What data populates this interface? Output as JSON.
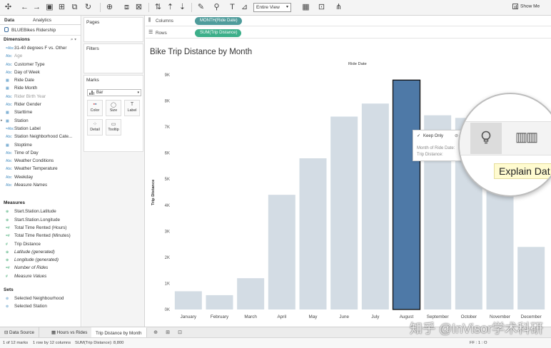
{
  "toolbar": {
    "fit_label": "Entire View",
    "show_me_label": "Show Me"
  },
  "data_pane": {
    "tabs": [
      "Data",
      "Analytics"
    ],
    "datasource": "BLUEBikes Ridership",
    "dimensions_header": "Dimensions",
    "dimensions": [
      {
        "type": "=Abc",
        "name": "31-40 degrees F vs. Other",
        "style": "dim"
      },
      {
        "type": "Abc",
        "name": "Age",
        "style": "muted"
      },
      {
        "type": "Abc",
        "name": "Customer Type",
        "style": "dim"
      },
      {
        "type": "Abc",
        "name": "Day of Week",
        "style": "dim"
      },
      {
        "type": "▦",
        "name": "Ride Date",
        "style": "dim"
      },
      {
        "type": "▦",
        "name": "Ride Month",
        "style": "dim"
      },
      {
        "type": "Abc",
        "name": "Rider Birth Year",
        "style": "muted"
      },
      {
        "type": "Abc",
        "name": "Rider Gender",
        "style": "dim"
      },
      {
        "type": "▦",
        "name": "Starttime",
        "style": "dim"
      },
      {
        "type": "▦",
        "name": "Station",
        "style": "dim",
        "arrow": true
      },
      {
        "type": "=Abc",
        "name": "Station Label",
        "style": "dim"
      },
      {
        "type": "Abc",
        "name": "Station Neighborhood Cate...",
        "style": "dim"
      },
      {
        "type": "▦",
        "name": "Stoptime",
        "style": "dim"
      },
      {
        "type": "Abc",
        "name": "Time of Day",
        "style": "dim"
      },
      {
        "type": "Abc",
        "name": "Weather Conditions",
        "style": "dim"
      },
      {
        "type": "Abc",
        "name": "Weather Temperature",
        "style": "dim"
      },
      {
        "type": "Abc",
        "name": "Weekday",
        "style": "dim"
      },
      {
        "type": "Abc",
        "name": "Measure Names",
        "style": "italic"
      }
    ],
    "measures_header": "Measures",
    "measures": [
      {
        "type": "⊕",
        "name": "Start.Station.Latitude",
        "style": "measure"
      },
      {
        "type": "⊕",
        "name": "Start.Station.Longitude",
        "style": "measure"
      },
      {
        "type": "=#",
        "name": "Total Time Rented (Hours)",
        "style": "measure"
      },
      {
        "type": "=#",
        "name": "Total Time Rented (Minutes)",
        "style": "measure"
      },
      {
        "type": "#",
        "name": "Trip Distance",
        "style": "measure"
      },
      {
        "type": "⊕",
        "name": "Latitude (generated)",
        "style": "measure italic"
      },
      {
        "type": "⊕",
        "name": "Longitude (generated)",
        "style": "measure italic"
      },
      {
        "type": "=#",
        "name": "Number of Rides",
        "style": "measure italic"
      },
      {
        "type": "#",
        "name": "Measure Values",
        "style": "measure italic"
      }
    ],
    "sets_header": "Sets",
    "sets": [
      {
        "type": "⊚",
        "name": "Selected Neighbourhood",
        "style": "dim"
      },
      {
        "type": "⊚",
        "name": "Selected Station",
        "style": "dim"
      }
    ]
  },
  "cards": {
    "pages": "Pages",
    "filters": "Filters",
    "marks": "Marks",
    "mark_type": "Bar",
    "buttons": [
      {
        "label": "Color",
        "icon": "▪▪"
      },
      {
        "label": "Size",
        "icon": "◯"
      },
      {
        "label": "Label",
        "icon": "T"
      },
      {
        "label": "Detail",
        "icon": "⁘"
      },
      {
        "label": "Tooltip",
        "icon": "▭"
      }
    ]
  },
  "shelves": {
    "columns_label": "Columns",
    "columns_pill": "MONTH(Ride Date)",
    "rows_label": "Rows",
    "rows_pill": "SUM(Trip Distance)"
  },
  "viz": {
    "title": "Bike Trip Distance by Month"
  },
  "chart_data": {
    "type": "bar",
    "title": "Bike Trip Distance by Month",
    "xlabel": "Ride Date",
    "ylabel": "Trip Distance",
    "categories": [
      "January",
      "February",
      "March",
      "April",
      "May",
      "June",
      "July",
      "August",
      "September",
      "October",
      "November",
      "December"
    ],
    "values": [
      700,
      550,
      1200,
      4400,
      5800,
      7400,
      7900,
      8800,
      7450,
      7350,
      6900,
      2400
    ],
    "ylim": [
      0,
      9000
    ],
    "yticks": [
      "0K",
      "1K",
      "2K",
      "3K",
      "4K",
      "5K",
      "6K",
      "7K",
      "8K",
      "9K"
    ],
    "highlighted": "August",
    "bar_color": "#d3dce4",
    "highlight_color": "#4e79a7",
    "grid": false
  },
  "tooltip": {
    "keep_only": "Keep Only",
    "line1": "Month of Ride Date:",
    "line2": "Trip Distance:"
  },
  "magnifier": {
    "tip": "Explain Dat"
  },
  "sheet_tabs": {
    "data_source": "Data Source",
    "tabs": [
      "Hours vs Rides",
      "Trip Distance by Month"
    ]
  },
  "status": {
    "marks": "1 of 12 marks",
    "rows_cols": "1 row by 12 columns",
    "sum": "SUM(Trip Distance): 8,800",
    "pager": "FF : 1 : O"
  },
  "watermark": "知乎 @InVisor学术科研"
}
